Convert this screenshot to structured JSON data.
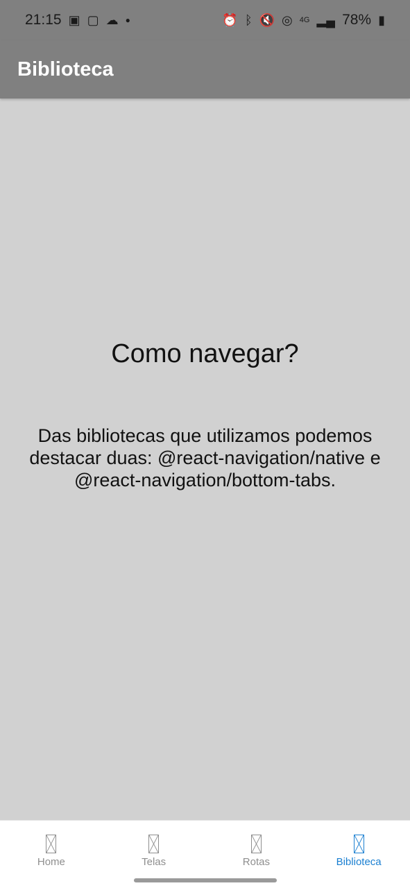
{
  "status_bar": {
    "time": "21:15",
    "battery": "78%",
    "left_icons": [
      "image-icon",
      "chat-icon",
      "cloud-icon",
      "dot-icon"
    ],
    "right_icons": [
      "alarm-icon",
      "bluetooth-icon",
      "mute-icon",
      "hotspot-icon",
      "network-4g-icon",
      "signal-icon",
      "battery-icon"
    ]
  },
  "header": {
    "title": "Biblioteca"
  },
  "content": {
    "title": "Como navegar?",
    "body": "Das bibliotecas que utilizamos podemos destacar duas: @react-navigation/native e @react-navigation/bottom-tabs."
  },
  "tabs": [
    {
      "label": "Home",
      "active": false
    },
    {
      "label": "Telas",
      "active": false
    },
    {
      "label": "Rotas",
      "active": false
    },
    {
      "label": "Biblioteca",
      "active": true
    }
  ],
  "colors": {
    "header_bg": "#808080",
    "content_bg": "#d1d1d1",
    "tab_active": "#1a7fd1",
    "tab_inactive": "#8e8e8e"
  }
}
